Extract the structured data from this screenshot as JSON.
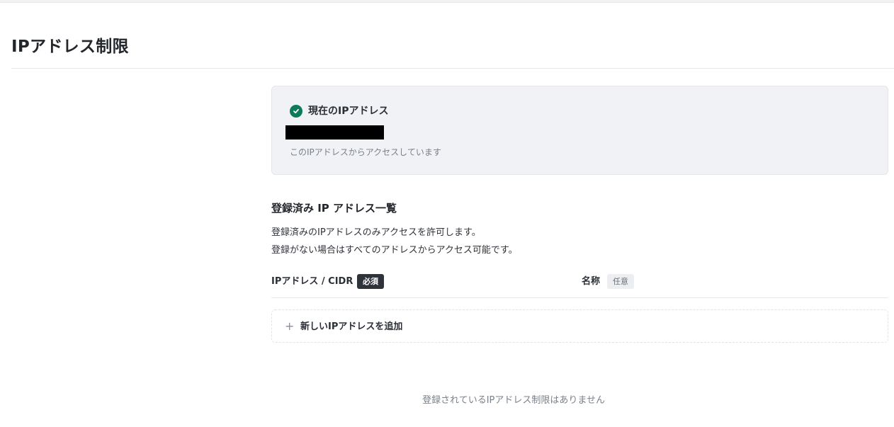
{
  "page": {
    "title": "IPアドレス制限"
  },
  "current_ip": {
    "label": "現在のIPアドレス",
    "value": "",
    "note": "このIPアドレスからアクセスしています",
    "icon": "check-circle-icon",
    "icon_color": "#0e7a5a"
  },
  "registered": {
    "title": "登録済み IP アドレス一覧",
    "description_line1": "登録済みのIPアドレスのみアクセスを許可します。",
    "description_line2": "登録がない場合はすべてのアドレスからアクセス可能です。",
    "columns": {
      "ip_label": "IPアドレス / CIDR",
      "ip_badge": "必須",
      "name_label": "名称",
      "name_badge": "任意"
    },
    "add_button_label": "新しいIPアドレスを追加",
    "empty_message": "登録されているIPアドレス制限はありません"
  }
}
